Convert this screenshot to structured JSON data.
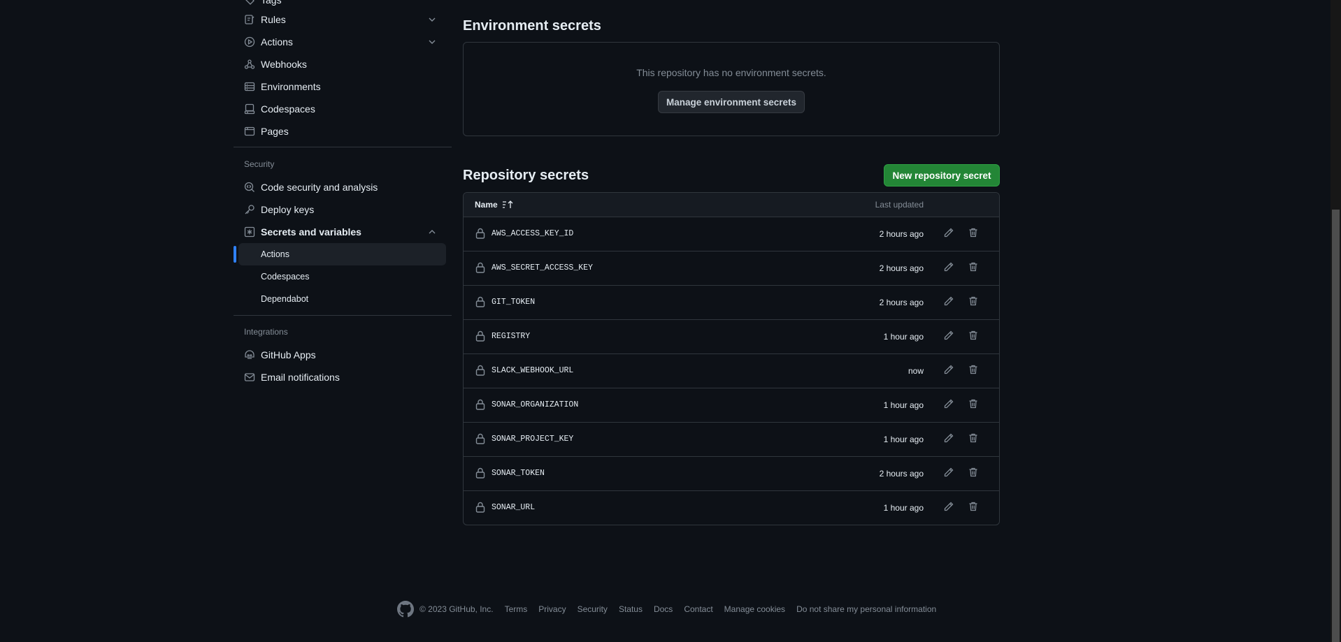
{
  "sidebar": {
    "top_partial_label": "Tags",
    "items": [
      {
        "label": "Rules",
        "icon": "rules-icon",
        "expandable": true
      },
      {
        "label": "Actions",
        "icon": "play-icon",
        "expandable": true
      },
      {
        "label": "Webhooks",
        "icon": "webhook-icon"
      },
      {
        "label": "Environments",
        "icon": "server-icon"
      },
      {
        "label": "Codespaces",
        "icon": "codespaces-icon"
      },
      {
        "label": "Pages",
        "icon": "browser-icon"
      }
    ],
    "security_heading": "Security",
    "security_items": [
      {
        "label": "Code security and analysis",
        "icon": "codescan-icon"
      },
      {
        "label": "Deploy keys",
        "icon": "key-icon"
      },
      {
        "label": "Secrets and variables",
        "icon": "key-asterisk-icon"
      }
    ],
    "secrets_subitems": [
      "Actions",
      "Codespaces",
      "Dependabot"
    ],
    "integrations_heading": "Integrations",
    "integrations_items": [
      {
        "label": "GitHub Apps",
        "icon": "hubot-icon"
      },
      {
        "label": "Email notifications",
        "icon": "mail-icon"
      }
    ]
  },
  "environment_secrets": {
    "title": "Environment secrets",
    "empty_text": "This repository has no environment secrets.",
    "manage_button": "Manage environment secrets"
  },
  "repository_secrets": {
    "title": "Repository secrets",
    "new_button": "New repository secret",
    "col_name": "Name",
    "col_updated": "Last updated",
    "rows": [
      {
        "name": "AWS_ACCESS_KEY_ID",
        "updated": "2 hours ago"
      },
      {
        "name": "AWS_SECRET_ACCESS_KEY",
        "updated": "2 hours ago"
      },
      {
        "name": "GIT_TOKEN",
        "updated": "2 hours ago"
      },
      {
        "name": "REGISTRY",
        "updated": "1 hour ago"
      },
      {
        "name": "SLACK_WEBHOOK_URL",
        "updated": "now"
      },
      {
        "name": "SONAR_ORGANIZATION",
        "updated": "1 hour ago"
      },
      {
        "name": "SONAR_PROJECT_KEY",
        "updated": "1 hour ago"
      },
      {
        "name": "SONAR_TOKEN",
        "updated": "2 hours ago"
      },
      {
        "name": "SONAR_URL",
        "updated": "1 hour ago"
      }
    ]
  },
  "footer": {
    "copyright": "© 2023 GitHub, Inc.",
    "links": [
      "Terms",
      "Privacy",
      "Security",
      "Status",
      "Docs",
      "Contact",
      "Manage cookies",
      "Do not share my personal information"
    ]
  },
  "colors": {
    "background": "#0d1117",
    "accent": "#2f81f7",
    "primary_button": "#238636"
  }
}
